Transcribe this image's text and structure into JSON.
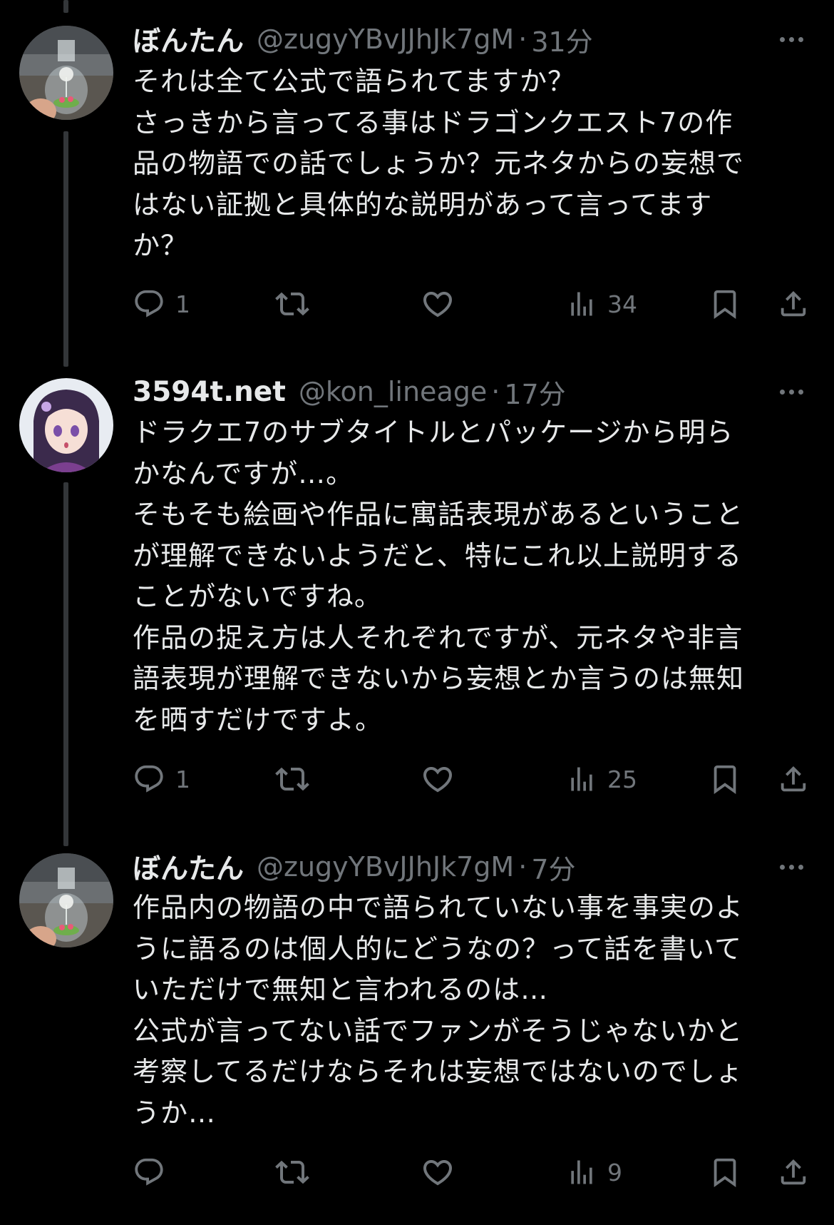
{
  "colors": {
    "background": "#000000",
    "text": "#e7e9ea",
    "secondary": "#71767b",
    "thread_line": "#333639"
  },
  "tweets": [
    {
      "name": "ぼんたん",
      "handle": "@zugyYBvJJhJk7gM",
      "separator": "·",
      "time": "31分",
      "lines": [
        "それは全て公式で語られてますか？",
        "さっきから言ってる事はドラゴンクエスト7の作",
        "品の物語での話でしょうか？元ネタからの妄想で",
        "はない証拠と具体的な説明があって言ってます",
        "か？"
      ],
      "actions": {
        "reply_icon": "reply-icon",
        "reply_count": "1",
        "retweet_icon": "retweet-icon",
        "like_icon": "like-icon",
        "views_icon": "views-icon",
        "views_count": "34",
        "bookmark_icon": "bookmark-icon",
        "share_icon": "share-icon"
      }
    },
    {
      "name": "3594t.net",
      "handle": "@kon_lineage",
      "separator": "·",
      "time": "17分",
      "lines": [
        "ドラクエ7のサブタイトルとパッケージから明ら",
        "かなんですが…。",
        "そもそも絵画や作品に寓話表現があるということ",
        "が理解できないようだと、特にこれ以上説明する",
        "ことがないですね。",
        "作品の捉え方は人それぞれですが、元ネタや非言",
        "語表現が理解できないから妄想とか言うのは無知",
        "を晒すだけですよ。"
      ],
      "actions": {
        "reply_icon": "reply-icon",
        "reply_count": "1",
        "retweet_icon": "retweet-icon",
        "like_icon": "like-icon",
        "views_icon": "views-icon",
        "views_count": "25",
        "bookmark_icon": "bookmark-icon",
        "share_icon": "share-icon"
      }
    },
    {
      "name": "ぼんたん",
      "handle": "@zugyYBvJJhJk7gM",
      "separator": "·",
      "time": "7分",
      "lines": [
        "作品内の物語の中で語られていない事を事実のよ",
        "うに語るのは個人的にどうなの？って話を書いて",
        "いただけで無知と言われるのは…",
        "公式が言ってない話でファンがそうじゃないかと",
        "考察してるだけならそれは妄想ではないのでしょ",
        "うか…"
      ],
      "actions": {
        "reply_icon": "reply-icon",
        "reply_count": "",
        "retweet_icon": "retweet-icon",
        "like_icon": "like-icon",
        "views_icon": "views-icon",
        "views_count": "9",
        "bookmark_icon": "bookmark-icon",
        "share_icon": "share-icon"
      }
    }
  ]
}
